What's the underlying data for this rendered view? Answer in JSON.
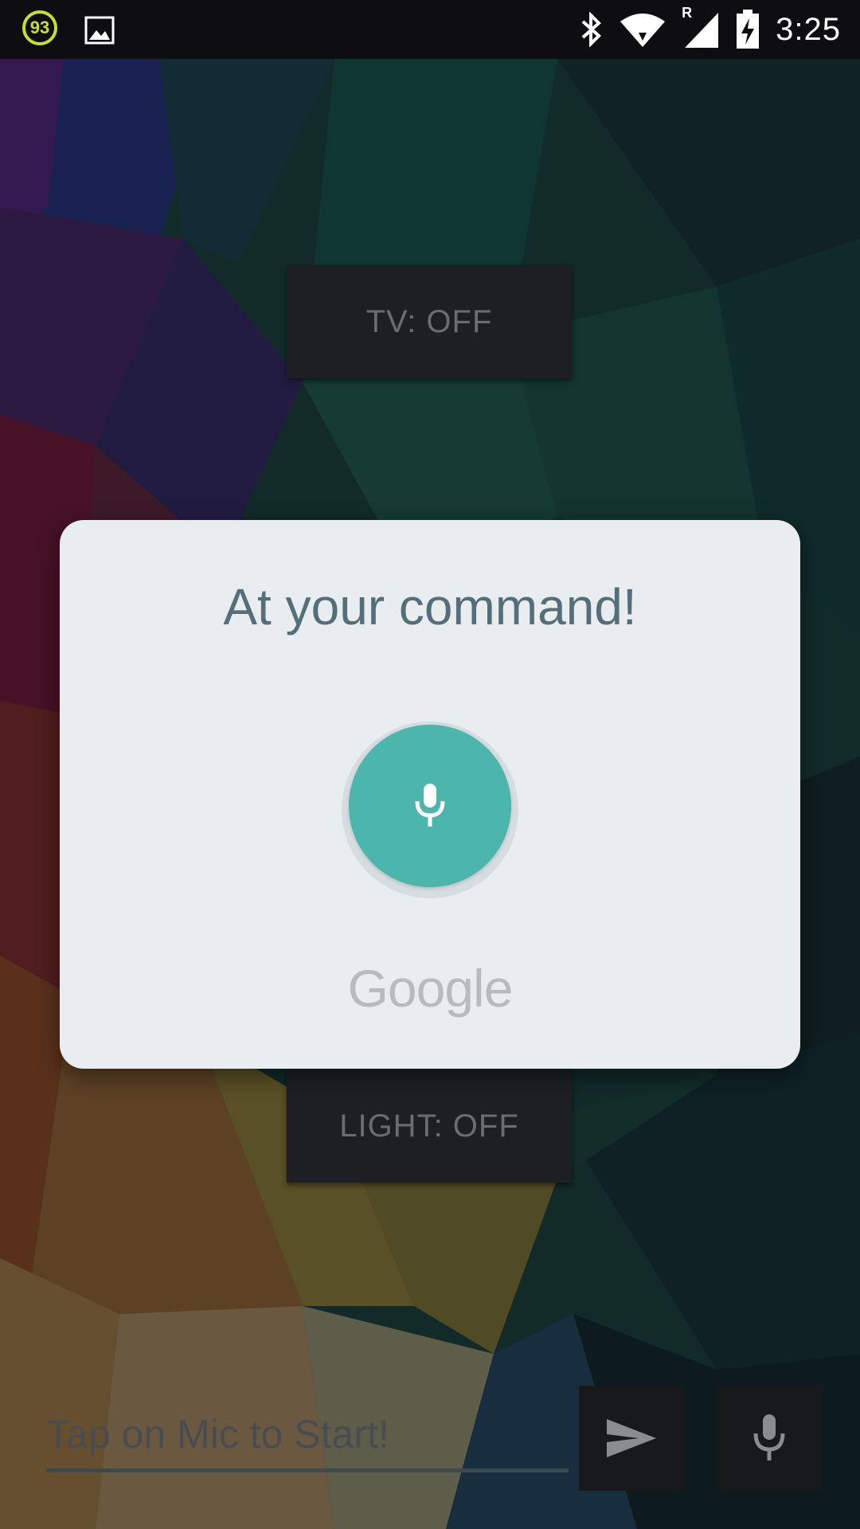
{
  "status_bar": {
    "notification_badge": "93",
    "time": "3:25",
    "icons": [
      "gallery-icon",
      "bluetooth-icon",
      "wifi-icon",
      "signal-roaming-icon",
      "battery-charging-icon"
    ],
    "roaming_label": "R"
  },
  "devices": {
    "tv_label": "TV: OFF",
    "light_label": "LIGHT: OFF"
  },
  "voice_dialog": {
    "title": "At your command!",
    "mic_icon": "mic-icon",
    "brand": "Google",
    "accent_color": "#4db6ac"
  },
  "input_bar": {
    "placeholder": "Tap on Mic to Start!",
    "send_icon": "send-icon",
    "mic_icon": "mic-icon"
  }
}
